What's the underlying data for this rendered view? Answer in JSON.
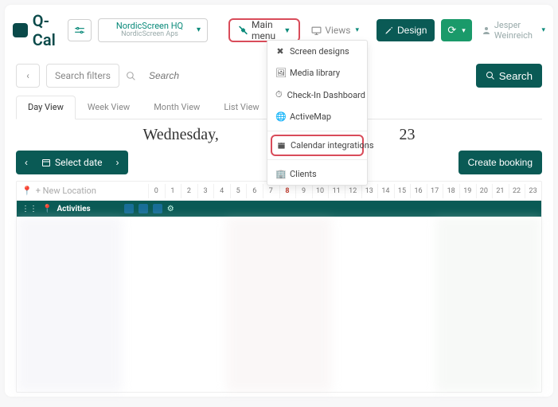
{
  "brand": "Q-Cal",
  "org": {
    "name": "NordicScreen HQ",
    "sub": "NordicScreen Aps"
  },
  "nav": {
    "main_menu_label": "Main menu",
    "views_label": "Views",
    "design_label": "Design"
  },
  "user": {
    "name": "Jesper Weinreich"
  },
  "menu": {
    "screen_designs": "Screen designs",
    "media_library": "Media library",
    "checkin_dashboard": "Check-In Dashboard",
    "activemap": "ActiveMap",
    "calendar_integrations": "Calendar integrations",
    "clients": "Clients"
  },
  "search": {
    "filters_label": "Search filters",
    "placeholder": "Search",
    "button": "Search"
  },
  "tabs": {
    "day": "Day View",
    "week": "Week View",
    "month": "Month View",
    "list": "List View"
  },
  "date_heading_prefix": "Wednesday,",
  "date_heading_suffix": "23",
  "date_picker_label": "Select date",
  "create_booking_label": "Create booking",
  "new_location_label": "+ New Location",
  "activities_label": "Activities",
  "hours": [
    "0",
    "1",
    "2",
    "3",
    "4",
    "5",
    "6",
    "7",
    "8",
    "9",
    "10",
    "11",
    "12",
    "13",
    "14",
    "15",
    "16",
    "17",
    "18",
    "19",
    "20",
    "21",
    "22",
    "23"
  ],
  "current_hour": "8"
}
